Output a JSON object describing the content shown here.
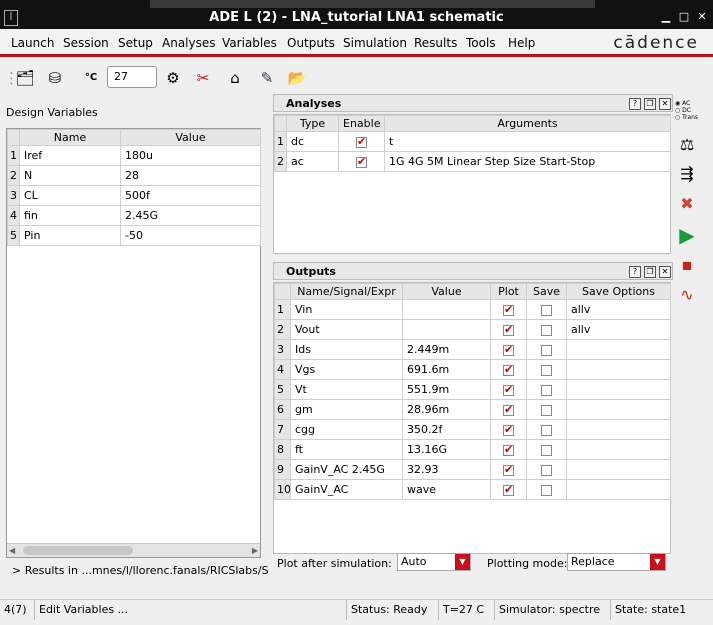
{
  "window": {
    "title": "ADE L (2) - LNA_tutorial LNA1 schematic",
    "icon_text": "ꟾ"
  },
  "menubar": {
    "items": [
      {
        "label": "Launch"
      },
      {
        "label": "Session"
      },
      {
        "label": "Setup"
      },
      {
        "label": "Analyses"
      },
      {
        "label": "Variables"
      },
      {
        "label": "Outputs"
      },
      {
        "label": "Simulation"
      },
      {
        "label": "Results"
      },
      {
        "label": "Tools"
      },
      {
        "label": "Help"
      }
    ],
    "logo": "cādence"
  },
  "toolbar": {
    "temp_unit": "°C",
    "temperature": "27"
  },
  "design_variables": {
    "title": "Design Variables",
    "columns": [
      "Name",
      "Value"
    ],
    "rows": [
      {
        "n": "1",
        "name": "Iref",
        "value": "180u"
      },
      {
        "n": "2",
        "name": "N",
        "value": "28"
      },
      {
        "n": "3",
        "name": "CL",
        "value": "500f"
      },
      {
        "n": "4",
        "name": "fin",
        "value": "2.45G"
      },
      {
        "n": "5",
        "name": "Pin",
        "value": "-50"
      }
    ],
    "results_path": "> Results in ...mnes/l/llorenc.fanals/RICSlabs/S"
  },
  "analyses": {
    "title": "Analyses",
    "columns": [
      "Type",
      "Enable",
      "Arguments"
    ],
    "rows": [
      {
        "n": "1",
        "type": "dc",
        "enable": true,
        "arguments": "t"
      },
      {
        "n": "2",
        "type": "ac",
        "enable": true,
        "arguments": "1G 4G 5M Linear Step Size Start-Stop"
      }
    ]
  },
  "outputs": {
    "title": "Outputs",
    "columns": [
      "Name/Signal/Expr",
      "Value",
      "Plot",
      "Save",
      "Save Options"
    ],
    "rows": [
      {
        "n": "1",
        "name": "Vin",
        "value": "",
        "plot": true,
        "save": false,
        "options": "allv"
      },
      {
        "n": "2",
        "name": "Vout",
        "value": "",
        "plot": true,
        "save": false,
        "options": "allv"
      },
      {
        "n": "3",
        "name": "Ids",
        "value": "2.449m",
        "plot": true,
        "save": false,
        "options": ""
      },
      {
        "n": "4",
        "name": "Vgs",
        "value": "691.6m",
        "plot": true,
        "save": false,
        "options": ""
      },
      {
        "n": "5",
        "name": "Vt",
        "value": "551.9m",
        "plot": true,
        "save": false,
        "options": ""
      },
      {
        "n": "6",
        "name": "gm",
        "value": "28.96m",
        "plot": true,
        "save": false,
        "options": ""
      },
      {
        "n": "7",
        "name": "cgg",
        "value": "350.2f",
        "plot": true,
        "save": false,
        "options": ""
      },
      {
        "n": "8",
        "name": "ft",
        "value": "13.16G",
        "plot": true,
        "save": false,
        "options": ""
      },
      {
        "n": "9",
        "name": "GainV_AC 2.45G",
        "value": "32.93",
        "plot": true,
        "save": false,
        "options": ""
      },
      {
        "n": "10",
        "name": "GainV_AC",
        "value": "wave",
        "plot": true,
        "save": false,
        "options": ""
      }
    ],
    "plot_after_label": "Plot after simulation:",
    "plot_after_value": "Auto",
    "plotting_mode_label": "Plotting mode:",
    "plotting_mode_value": "Replace"
  },
  "right_toolbar": {
    "mode_options": [
      "AC",
      "DC",
      "Trans"
    ]
  },
  "statusbar": {
    "index": "4(7)",
    "action": "Edit Variables ...",
    "status": "Status: Ready",
    "temperature": "T=27 C",
    "simulator": "Simulator: spectre",
    "state": "State: state1"
  },
  "colors": {
    "accent_red": "#b5121b",
    "titlebar": "#111111",
    "check_red": "#cc0000"
  }
}
